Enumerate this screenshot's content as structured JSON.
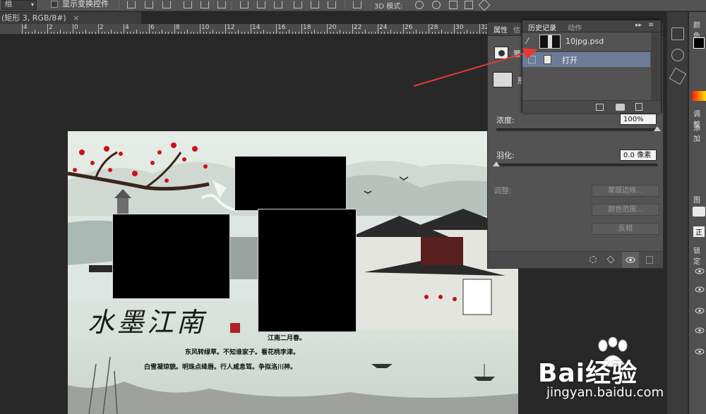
{
  "options_bar": {
    "group_dropdown": "组",
    "transform_controls_label": "显示变换控件",
    "mode_3d_label": "3D 模式:"
  },
  "document_tab": {
    "title": "(矩形 3, RGB/8#)",
    "close": "×"
  },
  "ruler": {
    "labels": [
      "4",
      "2",
      "0",
      "2",
      "4",
      "6",
      "8",
      "10",
      "12",
      "14",
      "16",
      "18",
      "20",
      "22",
      "24",
      "26",
      "28",
      "30",
      "32"
    ]
  },
  "canvas": {
    "title_calligraphy": "水墨江南",
    "poem": {
      "line1": "江南二月春。",
      "line2": "东风转绿草。不知谁家子。看花桃李津。",
      "line3": "白雪凝琼貌。明珠点绛唇。行人咸息驾。争拟洛川神。"
    }
  },
  "properties_panel": {
    "tabs": [
      "属性",
      "信"
    ],
    "mask_label": "蒙",
    "shape_label": "形",
    "density_label": "浓度:",
    "density_value": "100%",
    "density_level": 1.0,
    "feather_label": "羽化:",
    "feather_value": "0.0 像素",
    "adjust_label": "调整:",
    "buttons": {
      "mask_edge": "蒙版边缘...",
      "color_range": "颜色范围...",
      "invert": "反相"
    }
  },
  "history_panel": {
    "tabs": [
      "历史记录",
      "动作"
    ],
    "snapshot_name": "10jpg.psd",
    "steps": [
      "打开"
    ]
  },
  "right_column": {
    "labels": [
      "颜色",
      "调整",
      "添加",
      "图层",
      "正",
      "锁定"
    ]
  },
  "watermark": {
    "logo_text": "Bai经验",
    "url": "jingyan.baidu.com"
  },
  "colors": {
    "panel_bg": "#535353",
    "selected_row": "#6b7c96",
    "arrow": "#e53935",
    "plum_blossom": "#d0101a"
  }
}
